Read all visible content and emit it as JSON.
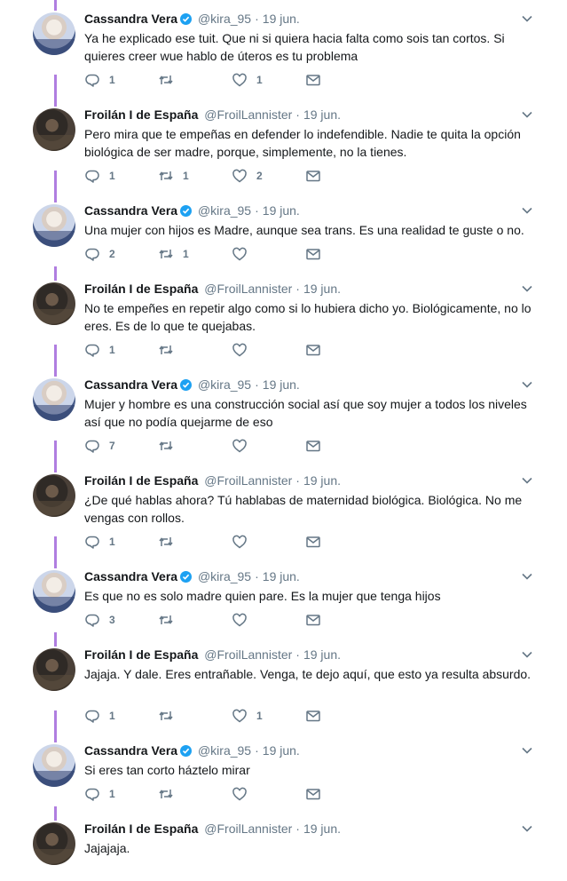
{
  "tweets": [
    {
      "author": "cv",
      "name": "Cassandra Vera",
      "verified": true,
      "handle": "@kira_95",
      "date": "19 jun.",
      "text": "Ya he explicado ese tuit. Que ni si quiera hacia falta como sois tan cortos. Si quieres creer wue hablo de úteros es tu problema",
      "replies": "1",
      "retweets": "",
      "likes": "1"
    },
    {
      "author": "fl",
      "name": "Froilán I de España",
      "verified": false,
      "handle": "@FroilLannister",
      "date": "19 jun.",
      "text": "Pero mira que te empeñas en defender lo indefendible. Nadie te quita la opción biológica de ser madre, porque, simplemente, no la tienes.",
      "replies": "1",
      "retweets": "1",
      "likes": "2"
    },
    {
      "author": "cv",
      "name": "Cassandra Vera",
      "verified": true,
      "handle": "@kira_95",
      "date": "19 jun.",
      "text": "Una mujer con hijos es Madre, aunque sea trans. Es una realidad te guste o no.",
      "replies": "2",
      "retweets": "1",
      "likes": ""
    },
    {
      "author": "fl",
      "name": "Froilán I de España",
      "verified": false,
      "handle": "@FroilLannister",
      "date": "19 jun.",
      "text": "No te empeñes en repetir algo como si lo hubiera dicho yo. Biológicamente, no lo eres. Es de lo que te quejabas.",
      "replies": "1",
      "retweets": "",
      "likes": ""
    },
    {
      "author": "cv",
      "name": "Cassandra Vera",
      "verified": true,
      "handle": "@kira_95",
      "date": "19 jun.",
      "text": "Mujer y hombre es una construcción social así que soy mujer a todos los niveles así que no podía quejarme de eso",
      "replies": "7",
      "retweets": "",
      "likes": ""
    },
    {
      "author": "fl",
      "name": "Froilán I de España",
      "verified": false,
      "handle": "@FroilLannister",
      "date": "19 jun.",
      "text": "¿De qué hablas ahora? Tú hablabas de maternidad biológica. Biológica. No me vengas con rollos.",
      "replies": "1",
      "retweets": "",
      "likes": ""
    },
    {
      "author": "cv",
      "name": "Cassandra Vera",
      "verified": true,
      "handle": "@kira_95",
      "date": "19 jun.",
      "text": "Es que no es solo madre quien pare. Es la mujer que tenga hijos",
      "replies": "3",
      "retweets": "",
      "likes": ""
    },
    {
      "author": "fl",
      "name": "Froilán I de España",
      "verified": false,
      "handle": "@FroilLannister",
      "date": "19 jun.",
      "text": "Jajaja. Y dale. Eres entrañable. Venga, te dejo aquí, que esto ya resulta absurdo.",
      "replies": "1",
      "retweets": "",
      "likes": "1"
    },
    {
      "author": "cv",
      "name": "Cassandra Vera",
      "verified": true,
      "handle": "@kira_95",
      "date": "19 jun.",
      "text": "Si eres tan corto háztelo mirar",
      "replies": "1",
      "retweets": "",
      "likes": ""
    },
    {
      "author": "fl",
      "name": "Froilán I de España",
      "verified": false,
      "handle": "@FroilLannister",
      "date": "19 jun.",
      "text": "Jajajaja.",
      "replies": "",
      "retweets": "",
      "likes": ""
    }
  ],
  "colors": {
    "thread_line": "#b07ee0",
    "verified": "#1da1f2",
    "muted": "#657786"
  },
  "icons": {
    "reply": "reply-icon",
    "retweet": "retweet-icon",
    "like": "heart-icon",
    "dm": "envelope-icon",
    "menu": "chevron-down-icon",
    "verified": "verified-badge-icon"
  }
}
